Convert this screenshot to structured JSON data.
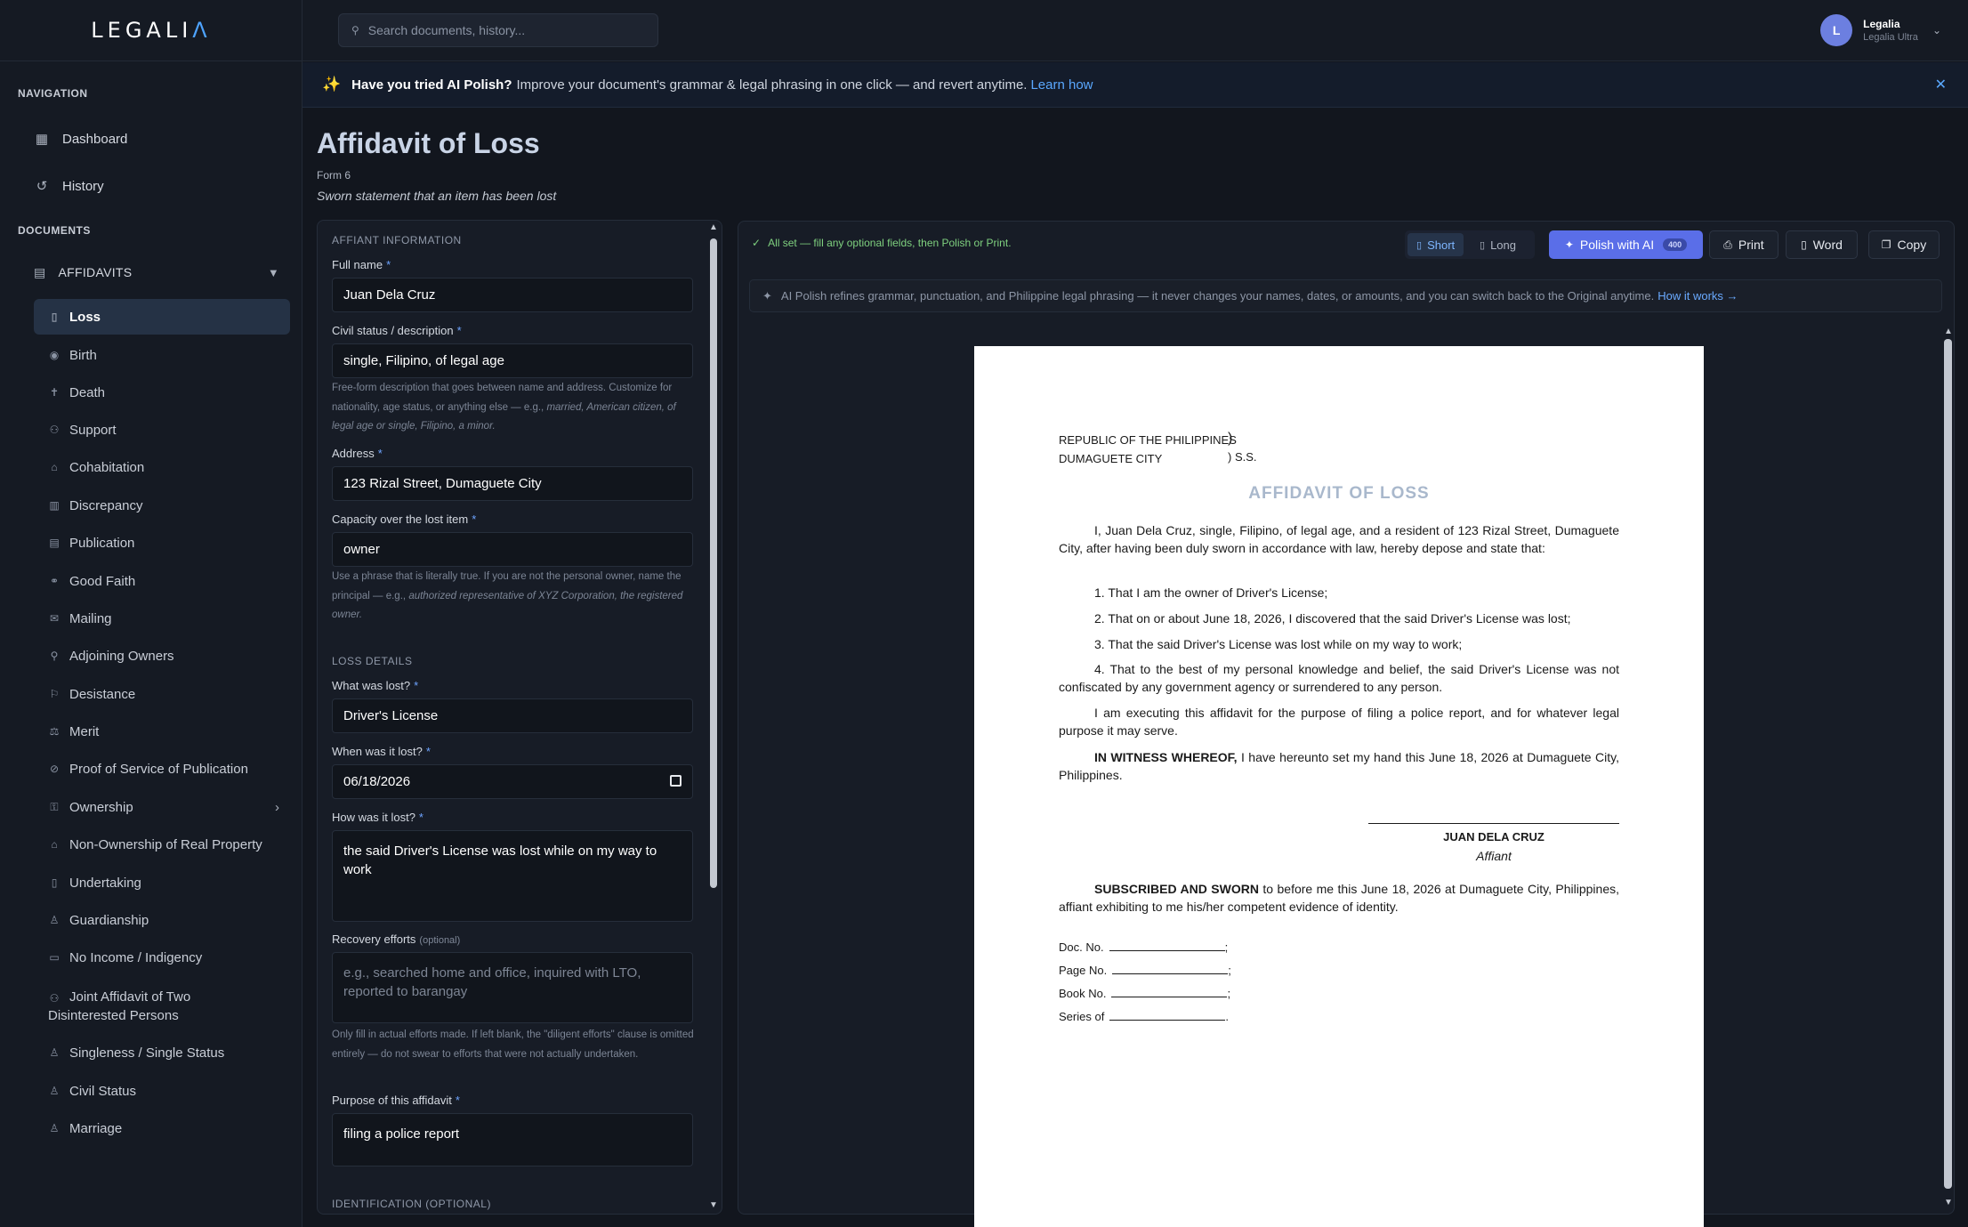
{
  "brand": {
    "logo_main": "LEGALI",
    "logo_accent": "Λ"
  },
  "search": {
    "placeholder": "Search documents, history..."
  },
  "user": {
    "initial": "L",
    "name": "Legalia",
    "plan": "Legalia Ultra"
  },
  "banner": {
    "bold": "Have you tried AI Polish?",
    "text": "Improve your document's grammar & legal phrasing in one click — and revert anytime.",
    "link": "Learn how"
  },
  "sidebar": {
    "navigation_label": "NAVIGATION",
    "nav_items": [
      {
        "label": "Dashboard",
        "icon": "grid-icon"
      },
      {
        "label": "History",
        "icon": "history-icon"
      }
    ],
    "documents_label": "DOCUMENTS",
    "group_label": "AFFIDAVITS",
    "sub_items": [
      {
        "label": "Loss",
        "active": true
      },
      {
        "label": "Birth"
      },
      {
        "label": "Death"
      },
      {
        "label": "Support"
      },
      {
        "label": "Cohabitation"
      },
      {
        "label": "Discrepancy"
      },
      {
        "label": "Publication"
      },
      {
        "label": "Good Faith"
      },
      {
        "label": "Mailing"
      },
      {
        "label": "Adjoining Owners"
      },
      {
        "label": "Desistance"
      },
      {
        "label": "Merit"
      },
      {
        "label": "Proof of Service of Publication"
      },
      {
        "label": "Ownership",
        "expandable": true
      },
      {
        "label": "Non-Ownership of Real Property"
      },
      {
        "label": "Undertaking"
      },
      {
        "label": "Guardianship"
      },
      {
        "label": "No Income / Indigency"
      },
      {
        "label": "Joint Affidavit of Two Disinterested Persons"
      },
      {
        "label": "Singleness / Single Status"
      },
      {
        "label": "Civil Status"
      },
      {
        "label": "Marriage"
      }
    ]
  },
  "page": {
    "title": "Affidavit of Loss",
    "form_no": "Form 6",
    "subtitle": "Sworn statement that an item has been lost"
  },
  "form": {
    "section_affiant": "AFFIANT INFORMATION",
    "full_name_label": "Full name",
    "full_name": "Juan Dela Cruz",
    "civil_label": "Civil status / description",
    "civil": "single, Filipino, of legal age",
    "civil_hint_a": "Free-form description that goes between name and address. Customize for nationality, age status, or anything else — e.g.,",
    "civil_hint_b": "married, American citizen, of legal age or single, Filipino, a minor.",
    "address_label": "Address",
    "address": "123 Rizal Street, Dumaguete City",
    "capacity_label": "Capacity over the lost item",
    "capacity": "owner",
    "capacity_hint_a": "Use a phrase that is literally true. If you are not the personal owner, name the principal — e.g.,",
    "capacity_hint_b": "authorized representative of XYZ Corporation, the registered owner.",
    "section_loss": "LOSS DETAILS",
    "what_label": "What was lost?",
    "what": "Driver's License",
    "when_label": "When was it lost?",
    "when": "06/18/2026",
    "how_label": "How was it lost?",
    "how": "the said Driver's License was lost while on my way to work",
    "recovery_label": "Recovery efforts",
    "optional": "(optional)",
    "recovery_placeholder": "e.g., searched home and office, inquired with LTO, reported to barangay",
    "recovery_hint": "Only fill in actual efforts made. If left blank, the \"diligent efforts\" clause is omitted entirely — do not swear to efforts that were not actually undertaken.",
    "purpose_label": "Purpose of this affidavit",
    "purpose": "filing a police report",
    "section_id": "IDENTIFICATION (OPTIONAL)",
    "required_mark": "*"
  },
  "preview": {
    "status": "All set — fill any optional fields, then Polish or Print.",
    "short": "Short",
    "long": "Long",
    "polish": "Polish with AI",
    "polish_badge": "400",
    "print": "Print",
    "word": "Word",
    "copy": "Copy",
    "info": "AI Polish refines grammar, punctuation, and Philippine legal phrasing — it never changes your names, dates, or amounts, and you can switch back to the Original anytime.",
    "info_link": "How it works →"
  },
  "document": {
    "caption_1": "REPUBLIC OF THE PHILIPPINES",
    "caption_2": "DUMAGUETE CITY",
    "paren": ")",
    "ss": ") S.S.",
    "title": "AFFIDAVIT OF LOSS",
    "intro": "I, Juan Dela Cruz, single, Filipino, of legal age, and a resident of 123 Rizal Street, Dumaguete City, after having been duly sworn in accordance with law, hereby depose and state that:",
    "item1": "1. That I am the owner of Driver's License;",
    "item2": "2. That on or about June 18, 2026, I discovered that the said Driver's License was lost;",
    "item3": "3. That the said Driver's License was lost while on my way to work;",
    "item4": "4. That to the best of my personal knowledge and belief, the said Driver's License was not confiscated by any government agency or surrendered to any person.",
    "executing": "I am executing this affidavit for the purpose of filing a police report, and for whatever legal purpose it may serve.",
    "witness_bold": "IN WITNESS WHEREOF,",
    "witness": "I have hereunto set my hand this June 18, 2026 at Dumaguete City, Philippines.",
    "sig_name": "JUAN DELA CRUZ",
    "sig_role": "Affiant",
    "sworn_bold": "SUBSCRIBED AND SWORN",
    "sworn": "to before me this June 18, 2026 at Dumaguete City, Philippines, affiant exhibiting to me his/her competent evidence of identity.",
    "doc_no": "Doc. No.",
    "page_no": "Page No.",
    "book_no": "Book No.",
    "series": "Series of",
    "semicolon": ";",
    "period": "."
  }
}
